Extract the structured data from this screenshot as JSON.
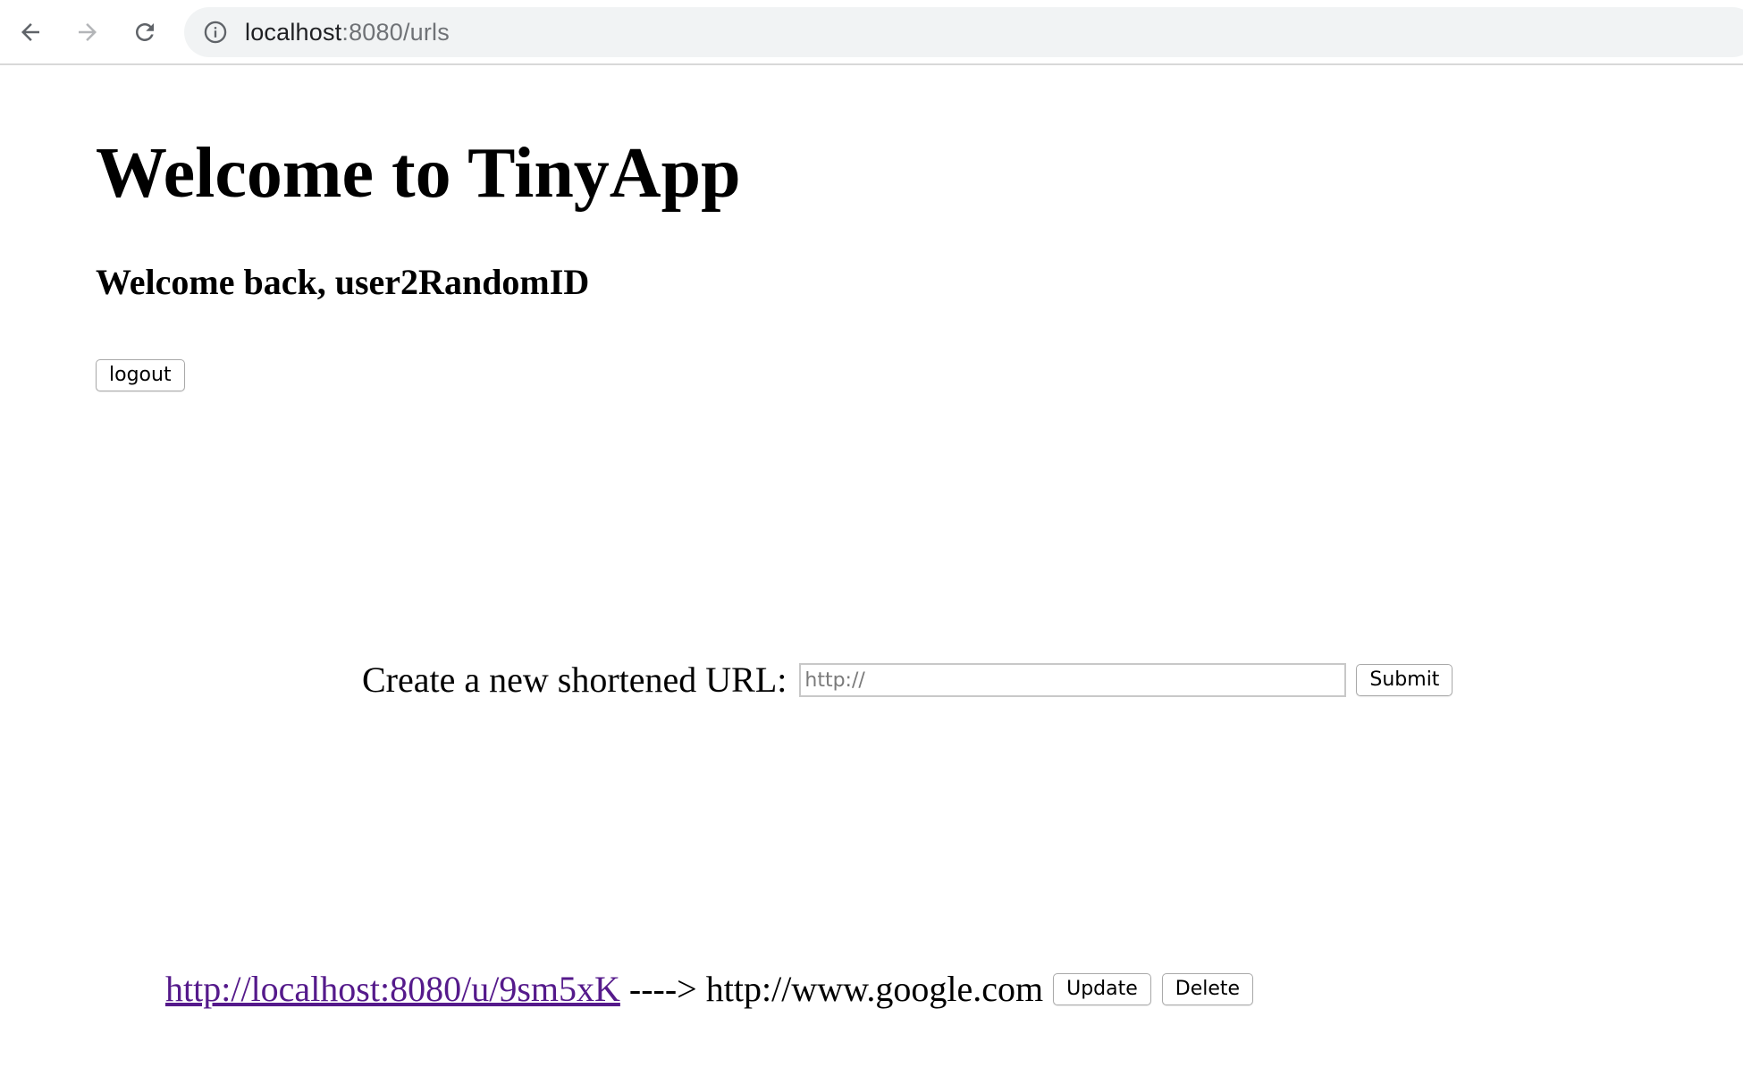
{
  "browser": {
    "address_host": "localhost",
    "address_rest": ":8080/urls",
    "back_icon": "arrow-left-icon",
    "forward_icon": "arrow-right-icon",
    "reload_icon": "reload-icon",
    "site_info_icon": "info-icon"
  },
  "page": {
    "title": "Welcome to TinyApp",
    "welcome_message": "Welcome back, user2RandomID",
    "logout_label": "logout"
  },
  "create_form": {
    "label": "Create a new shortened URL:",
    "input_placeholder": "http://",
    "input_value": "",
    "submit_label": "Submit"
  },
  "urls": [
    {
      "short_url": "http://localhost:8080/u/9sm5xK",
      "arrow": "---->",
      "long_url": "http://www.google.com",
      "update_label": "Update",
      "delete_label": "Delete"
    }
  ],
  "colors": {
    "visited_link": "#551a8b",
    "omnibox_bg": "#f1f3f4",
    "url_rest": "#6f7276"
  }
}
